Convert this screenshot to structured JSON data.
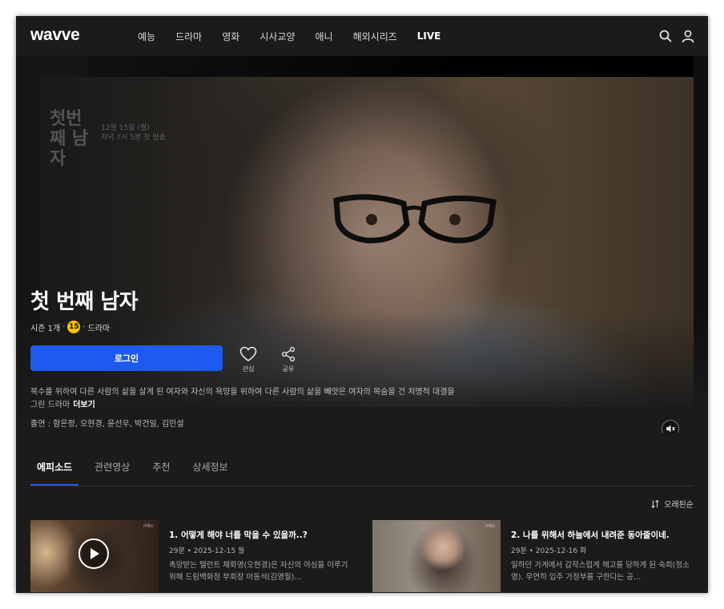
{
  "header": {
    "logo": "wavve",
    "nav": [
      "예능",
      "드라마",
      "영화",
      "시사교양",
      "애니",
      "해외시리즈",
      "LIVE"
    ],
    "icons": [
      "search-icon",
      "user-icon"
    ]
  },
  "hero": {
    "watermark_title": "첫번째 남자",
    "watermark_date": "12월 15일 (월)",
    "watermark_time": "저녁 7시 5분 첫 방송",
    "title": "첫 번째 남자",
    "meta": {
      "seasons": "시즌 1개",
      "age": "15",
      "genre": "드라마"
    },
    "login_button": "로그인",
    "actions": {
      "like": "관심",
      "share": "공유"
    },
    "description": "복수를 위하여 다른 사람의 삶을 살게 된 여자와 자신의 욕망을 위하여 다른 사람의 삶을 빼앗은 여자의 목숨을 건 치명적 대결을 그린 드라마",
    "more_link": "더보기",
    "cast": "출연 :   함은정, 오현경, 윤선우, 박건일, 김민설",
    "mute_icon": "mute-icon"
  },
  "tabs": {
    "items": [
      "에피소드",
      "관련영상",
      "추천",
      "상세정보"
    ],
    "active": "에피소드"
  },
  "sort_label": "오래된순",
  "episodes": [
    {
      "title": "1. 어떻게 해야 너를 막을 수 있을까..?",
      "duration": "29분",
      "date": "2025-12-15 월",
      "description": "촉망받는 탤런트 채화영(오현경)은 자신의 야심을 이루기 위해 드림백화점 부회장 마동석(김영필)…",
      "thumb_badge": "mbc"
    },
    {
      "title": "2. 나를 위해서 하늘에서 내려준 동아줄이네.",
      "duration": "29분",
      "date": "2025-12-16 화",
      "description": "일하던 가게에서 갑작스럽게 해고를 당하게 된 숙희(정소영). 우연히 입주 가정부를 구한다는 공…",
      "thumb_badge": "mbc"
    }
  ],
  "colors": {
    "background": "#1b1b1b",
    "accent": "#1e5af0",
    "age_badge": "#f5c400"
  }
}
